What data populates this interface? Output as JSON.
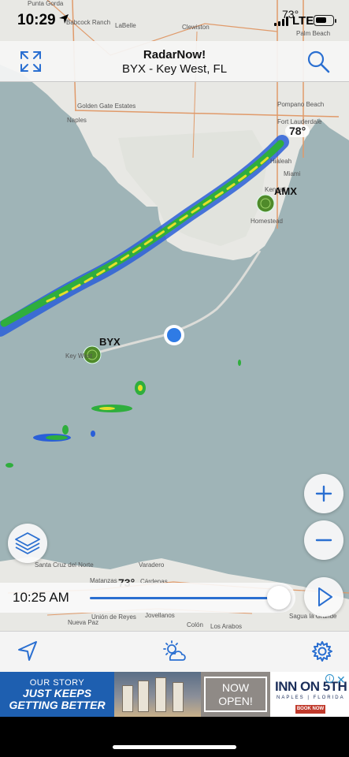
{
  "status_bar": {
    "time": "10:29",
    "temperature": "73°",
    "network": "LTE",
    "battery_level": 0.7
  },
  "header": {
    "title": "RadarNow!",
    "subtitle": "BYX - Key West, FL"
  },
  "map": {
    "place_labels": {
      "punta_gorda": "Punta Gorda",
      "babcock_ranch": "Babcock Ranch",
      "labelle": "LaBelle",
      "clewiston": "Clewiston",
      "palm_beach": "Palm Beach",
      "golden_gate_estates": "Golden Gate Estates",
      "naples": "Naples",
      "pompano_beach": "Pompano Beach",
      "fort_lauderdale": "Fort Lauderdale",
      "hialeah": "Hialeah",
      "miami": "Miami",
      "kendall": "Kendall",
      "homestead": "Homestead",
      "key_west": "Key West",
      "santa_cruz_del_norte": "Santa Cruz del Norte",
      "matanzas": "Matanzas",
      "cardenas": "Cárdenas",
      "varadero": "Varadero",
      "union_de_reyes": "Unión de Reyes",
      "jovellanos": "Jovellanos",
      "colon": "Colón",
      "los_arabos": "Los Arabos",
      "nueva_paz": "Nueva Paz",
      "sagua_la_grande": "Sagua la Grande"
    },
    "radar_sites": {
      "amx": "AMX",
      "byx": "BYX"
    },
    "temperatures": {
      "top": "73°",
      "fort_lauderdale": "78°",
      "cuba": "73°"
    }
  },
  "timeline": {
    "time": "10:25 AM",
    "progress": 0.98
  },
  "controls": {
    "zoom_in": "+",
    "zoom_out": "−"
  },
  "ad": {
    "left_line1": "OUR STORY",
    "left_line2": "JUST KEEPS",
    "left_line3": "GETTING BETTER",
    "mid_line1": "NOW",
    "mid_line2": "OPEN!",
    "brand": "INN ON 5TH",
    "brand_sub": "NAPLES | FLORIDA",
    "book": "BOOK NOW",
    "close": "✕"
  },
  "colors": {
    "accent": "#2a6fd1",
    "water": "#9fb4b7",
    "land": "#e8e8e4",
    "radar_green": "#2fae3d",
    "radar_yellow": "#e6df2a",
    "radar_blue": "#2a5fd8",
    "ad_blue": "#1e5fb0"
  },
  "icons": {
    "expand": "expand-arrows-icon",
    "search": "magnifier-icon",
    "layers": "layers-icon",
    "play": "play-icon",
    "location": "location-arrow-icon",
    "weather": "sun-cloud-icon",
    "settings": "gear-icon",
    "radar_site": "radar-dish-icon",
    "user_location": "location-dot-icon"
  }
}
